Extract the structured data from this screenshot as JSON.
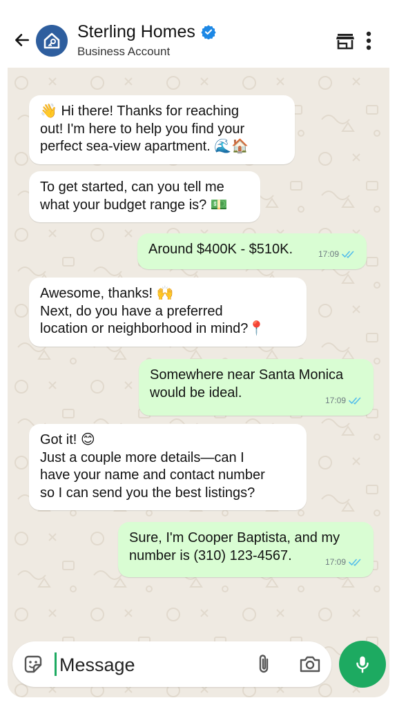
{
  "header": {
    "title": "Sterling Homes",
    "subtitle": "Business Account",
    "icons": {
      "back": "arrow-left-icon",
      "verified": "verified-badge-icon",
      "store": "store-icon",
      "menu": "more-vert-icon"
    }
  },
  "messages": [
    {
      "direction": "in",
      "lines": [
        "👋 Hi there! Thanks for reaching",
        "out! I'm here to help you find your",
        "perfect sea-view apartment. 🌊🏠"
      ]
    },
    {
      "direction": "in",
      "lines": [
        "To get started, can you tell me",
        "what your budget range is? 💵"
      ]
    },
    {
      "direction": "out",
      "lines": [
        "Around $400K - $510K."
      ],
      "time": "17:09",
      "status": "read"
    },
    {
      "direction": "in",
      "lines": [
        "Awesome, thanks! 🙌",
        "Next, do you have a preferred",
        "location or neighborhood in mind?📍"
      ]
    },
    {
      "direction": "out",
      "lines": [
        "Somewhere near Santa Monica",
        "would be ideal."
      ],
      "time": "17:09",
      "status": "read"
    },
    {
      "direction": "in",
      "lines": [
        "Got it! 😊",
        "Just a couple more details—can I",
        "have your name and contact number",
        "so I can send you the best listings?"
      ]
    },
    {
      "direction": "out",
      "lines": [
        "Sure, I'm Cooper Baptista, and my",
        "number is (310) 123-4567."
      ],
      "time": "17:09",
      "status": "read"
    }
  ],
  "composer": {
    "placeholder": "Message",
    "icons": {
      "sticker": "sticker-icon",
      "attach": "paperclip-icon",
      "camera": "camera-icon",
      "mic": "microphone-icon"
    }
  },
  "colors": {
    "outgoing_bubble": "#d9fdd3",
    "incoming_bubble": "#ffffff",
    "chat_background": "#efeae2",
    "accent_green": "#1daa61",
    "verified_blue": "#1d88e5",
    "read_ticks": "#53bdeb"
  }
}
